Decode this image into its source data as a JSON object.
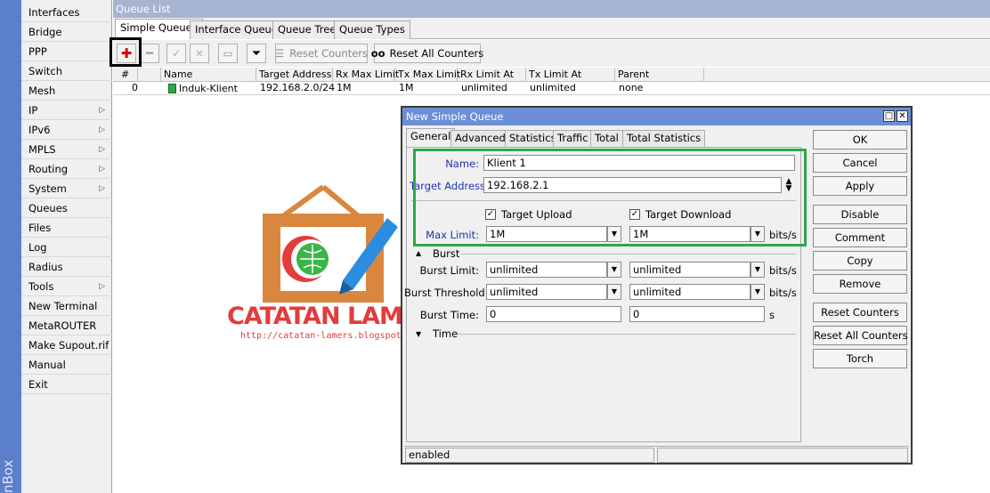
{
  "app": {
    "side_label": "nBox"
  },
  "sidebar": {
    "items": [
      {
        "label": "Interfaces",
        "submenu": false
      },
      {
        "label": "Bridge",
        "submenu": false
      },
      {
        "label": "PPP",
        "submenu": false
      },
      {
        "label": "Switch",
        "submenu": false
      },
      {
        "label": "Mesh",
        "submenu": false
      },
      {
        "label": "IP",
        "submenu": true
      },
      {
        "label": "IPv6",
        "submenu": true
      },
      {
        "label": "MPLS",
        "submenu": true
      },
      {
        "label": "Routing",
        "submenu": true
      },
      {
        "label": "System",
        "submenu": true
      },
      {
        "label": "Queues",
        "submenu": false
      },
      {
        "label": "Files",
        "submenu": false
      },
      {
        "label": "Log",
        "submenu": false
      },
      {
        "label": "Radius",
        "submenu": false
      },
      {
        "label": "Tools",
        "submenu": true
      },
      {
        "label": "New Terminal",
        "submenu": false
      },
      {
        "label": "MetaROUTER",
        "submenu": false
      },
      {
        "label": "Make Supout.rif",
        "submenu": false
      },
      {
        "label": "Manual",
        "submenu": false
      },
      {
        "label": "Exit",
        "submenu": false
      }
    ]
  },
  "queue_list": {
    "title": "Queue List",
    "tabs": [
      "Simple Queues",
      "Interface Queues",
      "Queue Tree",
      "Queue Types"
    ],
    "toolbar": {
      "reset_counters": "Reset Counters",
      "reset_all_counters": "Reset All Counters",
      "reset_all_prefix": "oo"
    },
    "columns": [
      "#",
      "Name",
      "Target Address",
      "Rx Max Limit",
      "Tx Max Limit",
      "Rx Limit At",
      "Tx Limit At",
      "Parent"
    ],
    "rows": [
      {
        "num": "0",
        "name": "Induk-Klient",
        "target": "192.168.2.0/24",
        "rx_max": "1M",
        "tx_max": "1M",
        "rx_at": "unlimited",
        "tx_at": "unlimited",
        "parent": "none"
      }
    ]
  },
  "dialog": {
    "title": "New Simple Queue",
    "tabs": [
      "General",
      "Advanced",
      "Statistics",
      "Traffic",
      "Total",
      "Total Statistics"
    ],
    "name_label": "Name:",
    "name_value": "Klient 1",
    "target_label": "Target Address:",
    "target_value": "192.168.2.1",
    "target_upload": "Target Upload",
    "target_download": "Target Download",
    "max_limit_label": "Max Limit:",
    "max_limit_up": "1M",
    "max_limit_down": "1M",
    "unit_bits": "bits/s",
    "burst_section": "Burst",
    "burst_limit_label": "Burst Limit:",
    "burst_limit_up": "unlimited",
    "burst_limit_down": "unlimited",
    "burst_threshold_label": "Burst Threshold:",
    "burst_threshold_up": "unlimited",
    "burst_threshold_down": "unlimited",
    "burst_time_label": "Burst Time:",
    "burst_time_up": "0",
    "burst_time_down": "0",
    "unit_s": "s",
    "time_section": "Time",
    "buttons": [
      "OK",
      "Cancel",
      "Apply",
      "Disable",
      "Comment",
      "Copy",
      "Remove",
      "Reset Counters",
      "Reset All Counters",
      "Torch"
    ],
    "status": "enabled"
  },
  "watermark": {
    "brand": "CATATAN LAMERS",
    "url": "http://catatan-lamers.blogspot.com"
  },
  "colors": {
    "highlight_green": "#2ca84a",
    "dialog_title": "#6b8ed6",
    "label_blue": "#1f31b8"
  }
}
